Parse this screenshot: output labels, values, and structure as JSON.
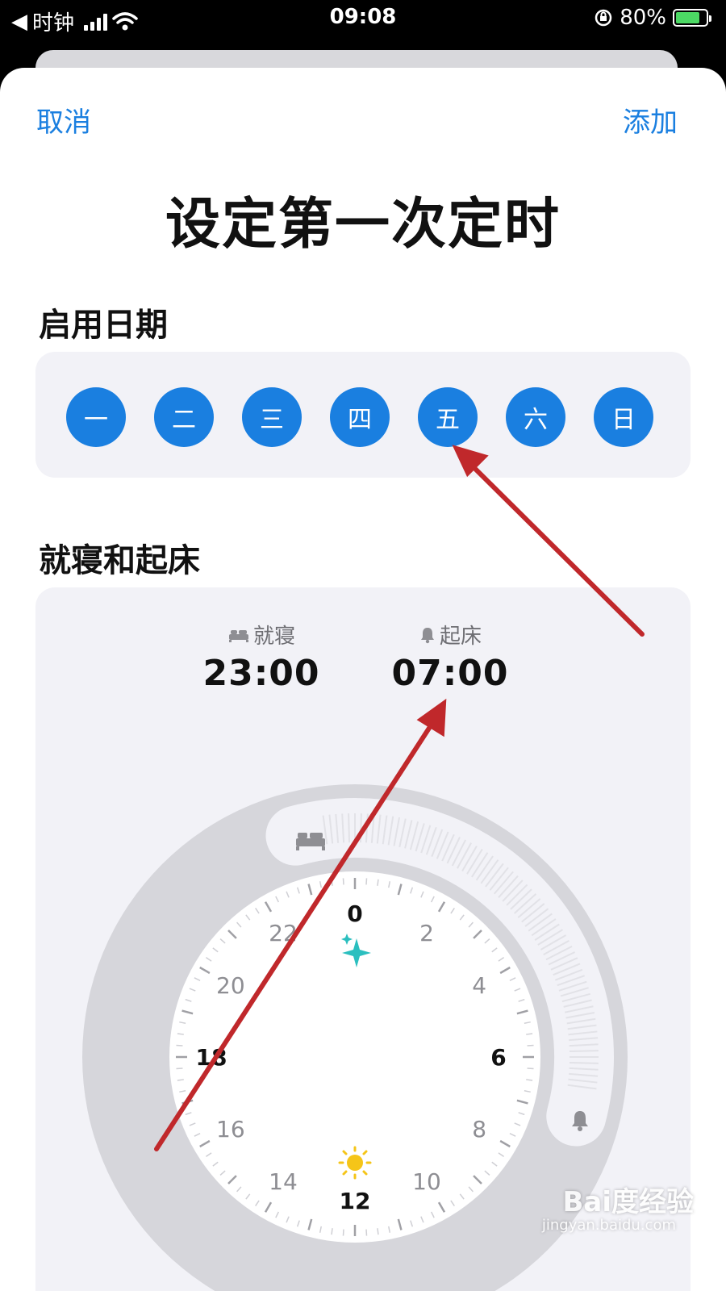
{
  "status_bar": {
    "back_app": "时钟",
    "time": "09:08",
    "battery": "80%",
    "battery_level": 0.8
  },
  "nav": {
    "cancel": "取消",
    "add": "添加"
  },
  "title": "设定第一次定时",
  "days_section": {
    "title": "启用日期",
    "days": [
      "一",
      "二",
      "三",
      "四",
      "五",
      "六",
      "日"
    ]
  },
  "sleep_section": {
    "title": "就寝和起床",
    "bedtime": {
      "label": "就寝",
      "value": "23:00",
      "icon": "bed-icon"
    },
    "wakeup": {
      "label": "起床",
      "value": "07:00",
      "icon": "bell-icon"
    },
    "clock_labels": [
      "0",
      "2",
      "4",
      "6",
      "8",
      "10",
      "12",
      "14",
      "16",
      "18",
      "20",
      "22"
    ]
  },
  "colors": {
    "accent": "#1a7fe0",
    "annotation_arrow": "#c0282b",
    "sparkle": "#2bbfbf",
    "sun": "#f5c518"
  },
  "watermark": {
    "brand": "Bai度经验",
    "url": "jingyan.baidu.com"
  }
}
